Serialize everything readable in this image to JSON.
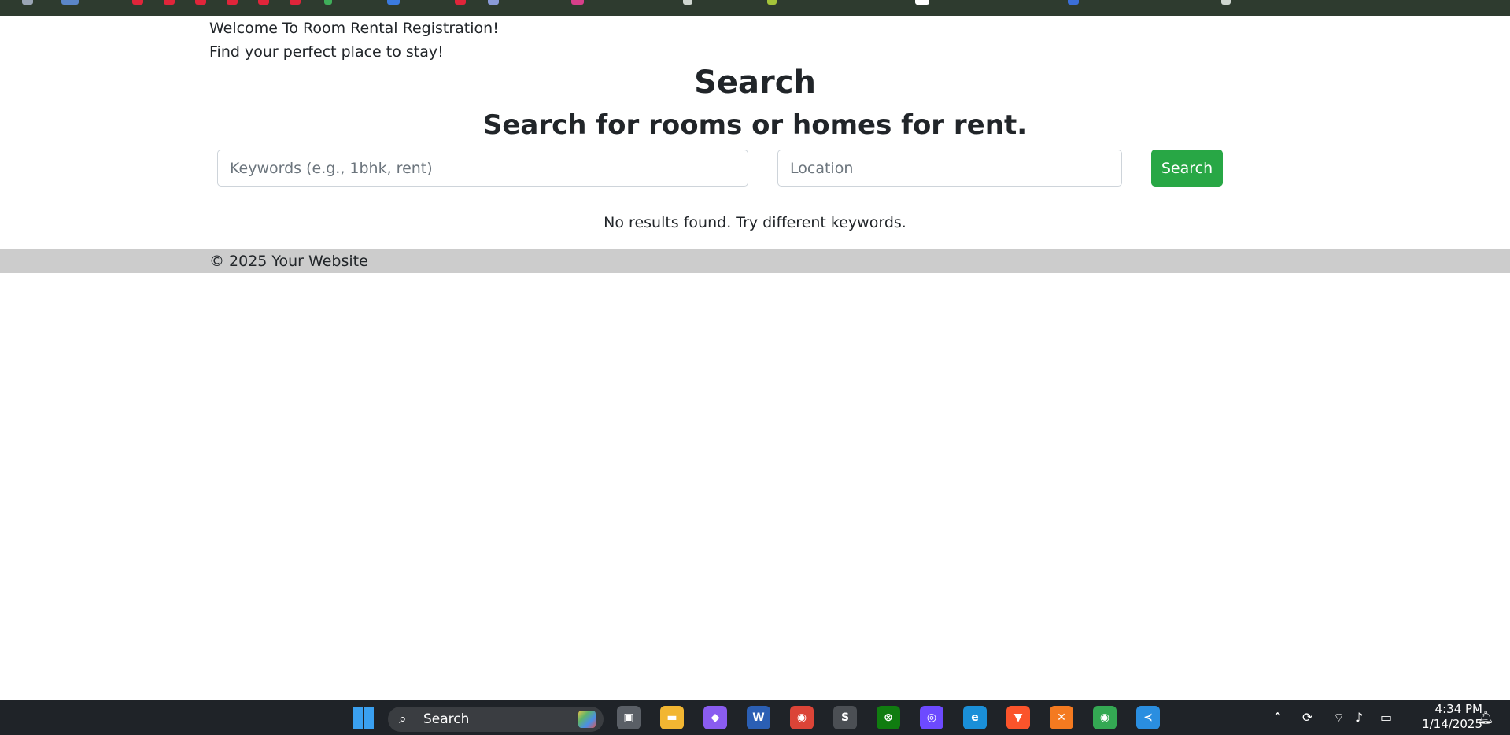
{
  "header": {
    "welcome": "Welcome To Room Rental Registration!",
    "tagline": "Find your perfect place to stay!"
  },
  "main": {
    "title": "Search",
    "subtitle": "Search for rooms or homes for rent.",
    "keywords_placeholder": "Keywords (e.g., 1bhk, rent)",
    "keywords_value": "",
    "location_placeholder": "Location",
    "location_value": "",
    "search_button": "Search",
    "no_results": "No results found. Try different keywords."
  },
  "footer": {
    "text": "© 2025 Your Website"
  },
  "taskbar": {
    "search_label": "Search",
    "time": "4:34 PM",
    "date": "1/14/2025",
    "apps": [
      {
        "icon": "task-view-icon",
        "glyph": "▣",
        "color": "#5a5f66"
      },
      {
        "icon": "file-explorer-icon",
        "glyph": "▬",
        "color": "#f2b632"
      },
      {
        "icon": "copilot-icon",
        "glyph": "◆",
        "color": "#8a5cf0"
      },
      {
        "icon": "word-icon",
        "glyph": "W",
        "color": "#2b5fb4"
      },
      {
        "icon": "chrome-icon",
        "glyph": "◉",
        "color": "#db4437"
      },
      {
        "icon": "sublime-text-icon",
        "glyph": "S",
        "color": "#4b4f54"
      },
      {
        "icon": "xbox-icon",
        "glyph": "⊗",
        "color": "#107c10"
      },
      {
        "icon": "proton-vpn-icon",
        "glyph": "◎",
        "color": "#6d4aff"
      },
      {
        "icon": "edge-icon",
        "glyph": "e",
        "color": "#1a8fd8"
      },
      {
        "icon": "brave-icon",
        "glyph": "▼",
        "color": "#fb542b"
      },
      {
        "icon": "xampp-icon",
        "glyph": "✕",
        "color": "#f47a20"
      },
      {
        "icon": "chrome-profile-icon",
        "glyph": "◉",
        "color": "#34a853"
      },
      {
        "icon": "vscode-icon",
        "glyph": "≺",
        "color": "#2a8ee0"
      }
    ]
  },
  "colors": {
    "accent_button": "#28a745",
    "footer_bg": "#cccccc",
    "bookmark_bar": "#2e3b2f",
    "taskbar_bg": "#1f2328"
  }
}
